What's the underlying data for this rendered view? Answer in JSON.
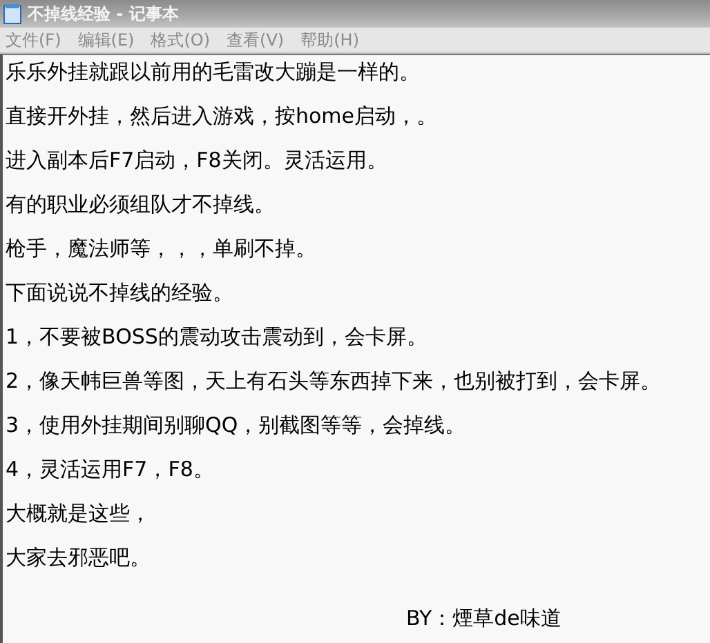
{
  "window": {
    "title": "不掉线经验 - 记事本"
  },
  "menu": [
    "文件(F)",
    "编辑(E)",
    "格式(O)",
    "查看(V)",
    "帮助(H)"
  ],
  "lines": [
    "乐乐外挂就跟以前用的毛雷改大蹦是一样的。",
    "直接开外挂，然后进入游戏，按home启动，。",
    "进入副本后F7启动，F8关闭。灵活运用。",
    "有的职业必须组队才不掉线。",
    "枪手，魔法师等，，，单刷不掉。",
    "下面说说不掉线的经验。",
    "1，不要被BOSS的震动攻击震动到，会卡屏。",
    "2，像天帏巨兽等图，天上有石头等东西掉下来，也别被打到，会卡屏。",
    "3，使用外挂期间别聊QQ，别截图等等，会掉线。",
    "4，灵活运用F7，F8。",
    "大概就是这些，",
    "大家去邪恶吧。"
  ],
  "signature": "BY：煙草de味道"
}
